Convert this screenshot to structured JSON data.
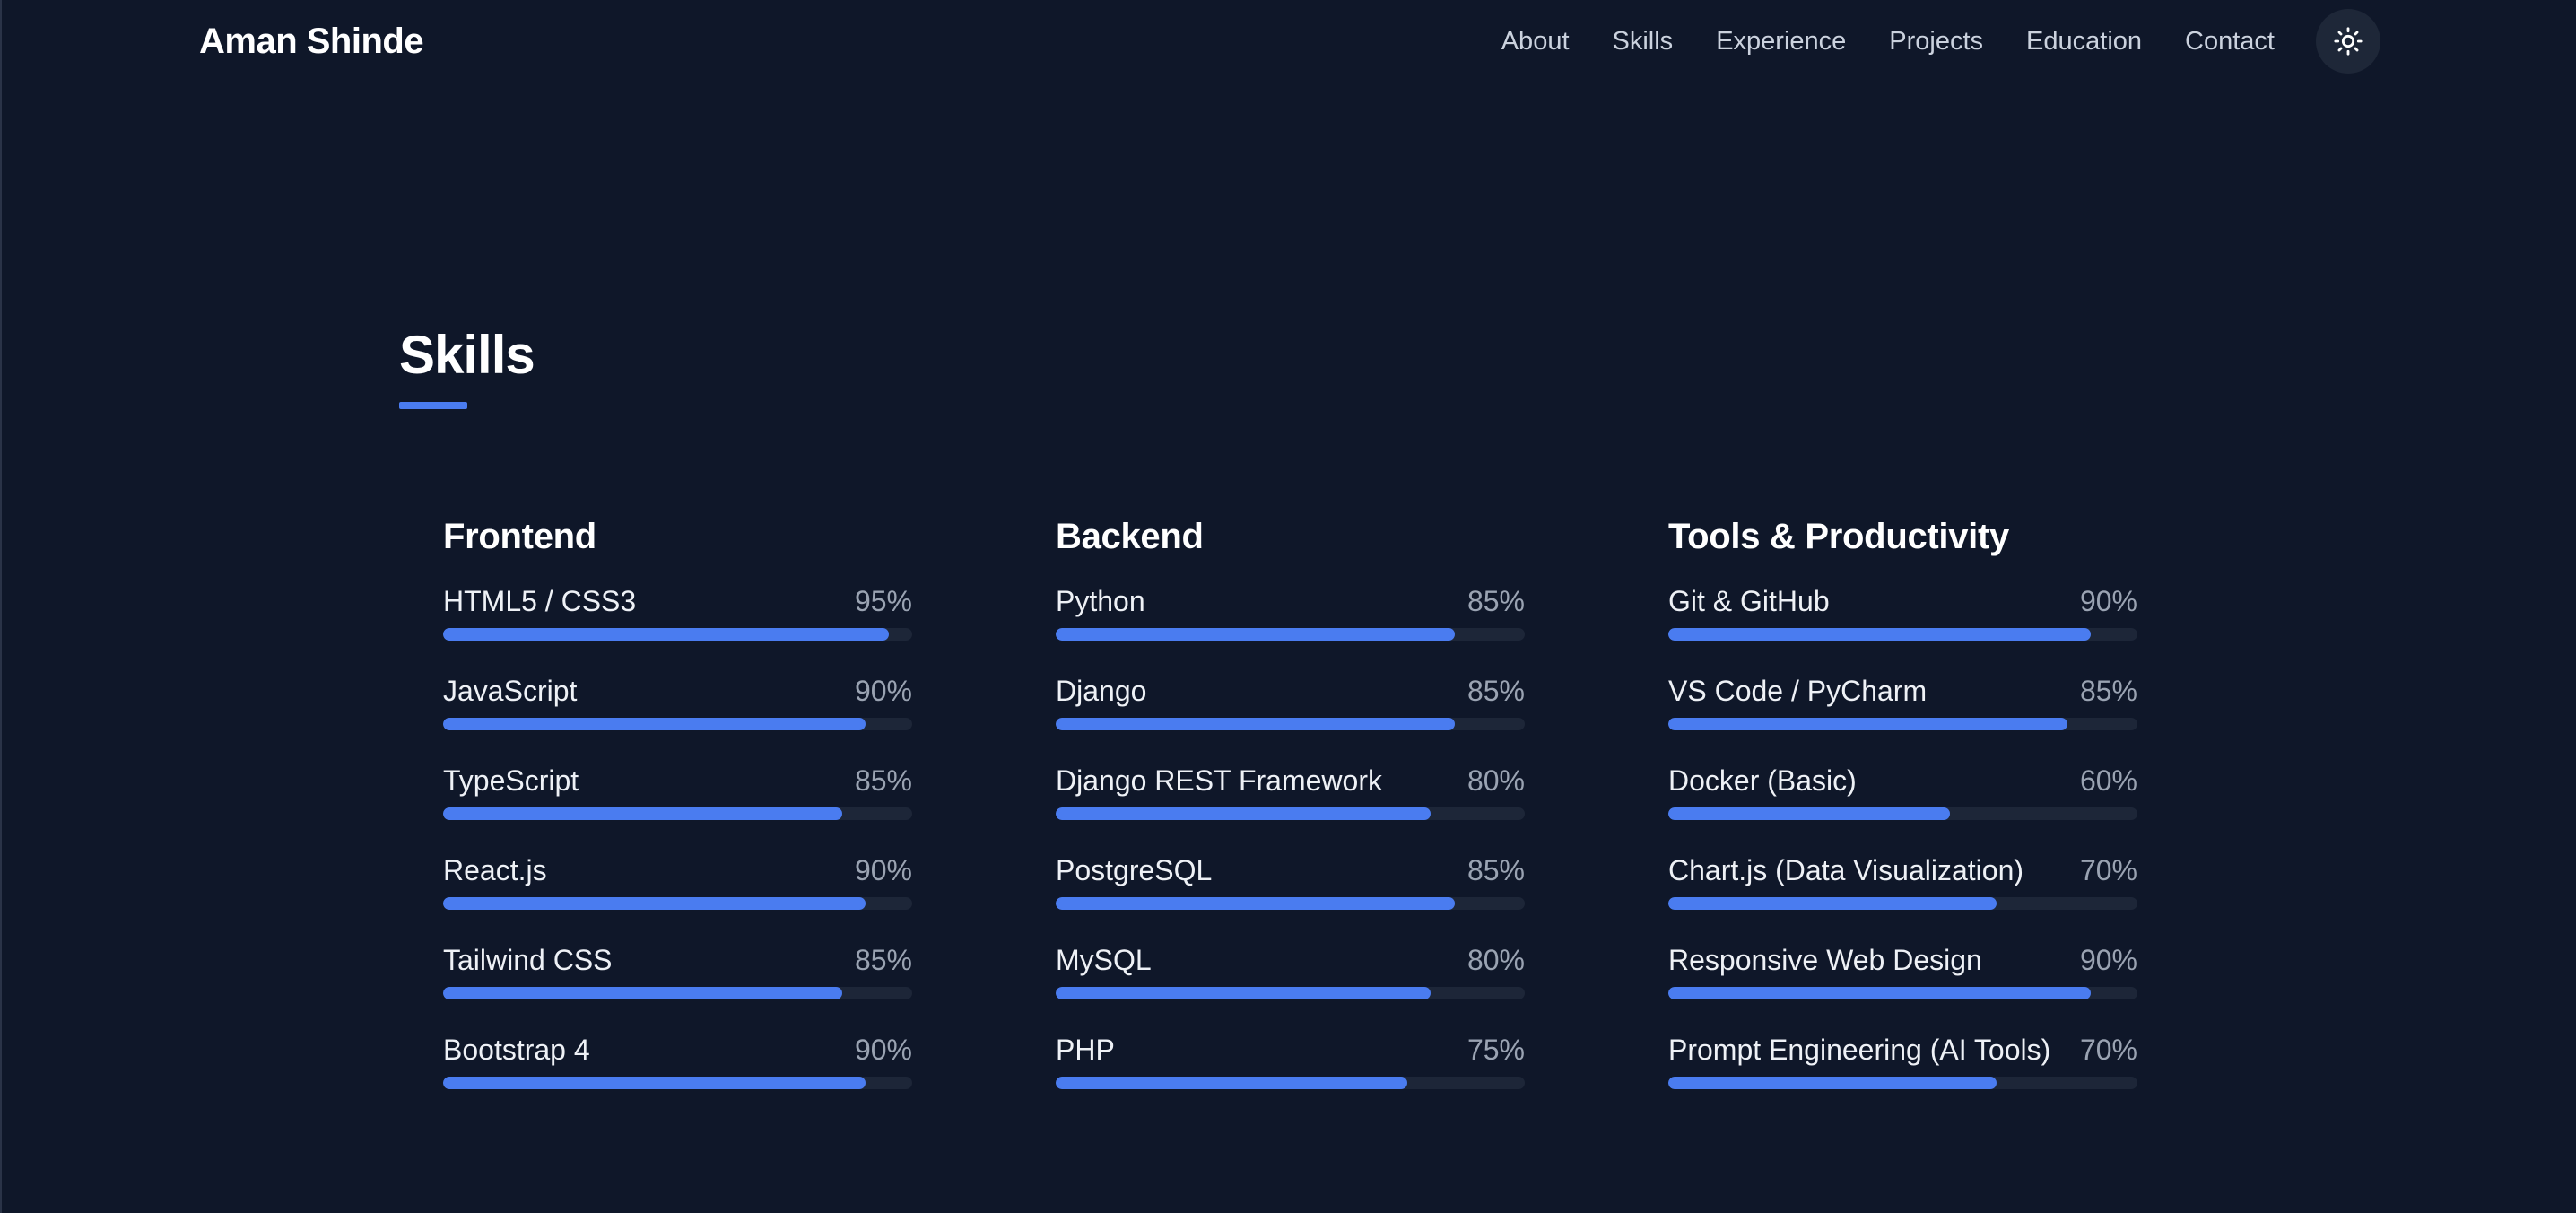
{
  "header": {
    "brand": "Aman Shinde",
    "nav": [
      "About",
      "Skills",
      "Experience",
      "Projects",
      "Education",
      "Contact"
    ],
    "theme_toggle_icon": "sun-icon"
  },
  "skills_section": {
    "title": "Skills",
    "accent_color": "#4a7cf0",
    "columns": [
      {
        "title": "Frontend",
        "skills": [
          {
            "name": "HTML5 / CSS3",
            "percent": "95%",
            "level": 95
          },
          {
            "name": "JavaScript",
            "percent": "90%",
            "level": 90
          },
          {
            "name": "TypeScript",
            "percent": "85%",
            "level": 85
          },
          {
            "name": "React.js",
            "percent": "90%",
            "level": 90
          },
          {
            "name": "Tailwind CSS",
            "percent": "85%",
            "level": 85
          },
          {
            "name": "Bootstrap 4",
            "percent": "90%",
            "level": 90
          }
        ]
      },
      {
        "title": "Backend",
        "skills": [
          {
            "name": "Python",
            "percent": "85%",
            "level": 85
          },
          {
            "name": "Django",
            "percent": "85%",
            "level": 85
          },
          {
            "name": "Django REST Framework",
            "percent": "80%",
            "level": 80
          },
          {
            "name": "PostgreSQL",
            "percent": "85%",
            "level": 85
          },
          {
            "name": "MySQL",
            "percent": "80%",
            "level": 80
          },
          {
            "name": "PHP",
            "percent": "75%",
            "level": 75
          }
        ]
      },
      {
        "title": "Tools & Productivity",
        "skills": [
          {
            "name": "Git & GitHub",
            "percent": "90%",
            "level": 90
          },
          {
            "name": "VS Code / PyCharm",
            "percent": "85%",
            "level": 85
          },
          {
            "name": "Docker (Basic)",
            "percent": "60%",
            "level": 60
          },
          {
            "name": "Chart.js (Data Visualization)",
            "percent": "70%",
            "level": 70
          },
          {
            "name": "Responsive Web Design",
            "percent": "90%",
            "level": 90
          },
          {
            "name": "Prompt Engineering (AI Tools)",
            "percent": "70%",
            "level": 70
          }
        ]
      }
    ]
  }
}
